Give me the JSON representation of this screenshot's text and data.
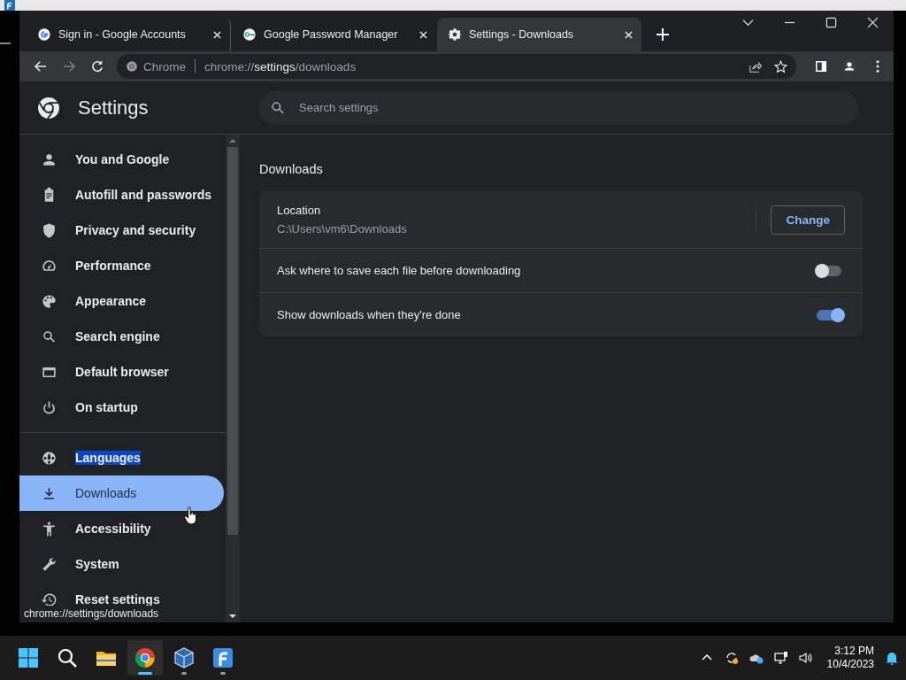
{
  "tabs": [
    {
      "label": "Sign in - Google Accounts",
      "selected": false
    },
    {
      "label": "Google Password Manager",
      "selected": false
    },
    {
      "label": "Settings - Downloads",
      "selected": true
    }
  ],
  "omnibox": {
    "chip": "Chrome",
    "url_prefix": "chrome://",
    "url_host": "settings",
    "url_path": "/downloads"
  },
  "header": {
    "title": "Settings",
    "search_placeholder": "Search settings"
  },
  "sidebar": {
    "items": [
      {
        "label": "You and Google",
        "selected": false,
        "highlighted": false
      },
      {
        "label": "Autofill and passwords",
        "selected": false,
        "highlighted": false
      },
      {
        "label": "Privacy and security",
        "selected": false,
        "highlighted": false
      },
      {
        "label": "Performance",
        "selected": false,
        "highlighted": false
      },
      {
        "label": "Appearance",
        "selected": false,
        "highlighted": false
      },
      {
        "label": "Search engine",
        "selected": false,
        "highlighted": false
      },
      {
        "label": "Default browser",
        "selected": false,
        "highlighted": false
      },
      {
        "label": "On startup",
        "selected": false,
        "highlighted": false
      },
      {
        "label": "Languages",
        "selected": false,
        "highlighted": true
      },
      {
        "label": "Downloads",
        "selected": true,
        "highlighted": false
      },
      {
        "label": "Accessibility",
        "selected": false,
        "highlighted": false
      },
      {
        "label": "System",
        "selected": false,
        "highlighted": false
      },
      {
        "label": "Reset settings",
        "selected": false,
        "highlighted": false
      }
    ]
  },
  "status_bubble": "chrome://settings/downloads",
  "section": {
    "title": "Downloads",
    "location": {
      "label": "Location",
      "path": "C:\\Users\\vm6\\Downloads",
      "button": "Change"
    },
    "toggles": [
      {
        "label": "Ask where to save each file before downloading",
        "on": false
      },
      {
        "label": "Show downloads when they're done",
        "on": true
      }
    ]
  },
  "taskbar": {
    "apps": [
      {
        "kind": "start",
        "selected": false
      },
      {
        "kind": "search",
        "selected": false
      },
      {
        "kind": "folder",
        "selected": false
      },
      {
        "kind": "chrome",
        "selected": true
      },
      {
        "kind": "box",
        "selected": false
      },
      {
        "kind": "fedora",
        "selected": false
      }
    ],
    "time": "3:12 PM",
    "date": "10/4/2023"
  }
}
